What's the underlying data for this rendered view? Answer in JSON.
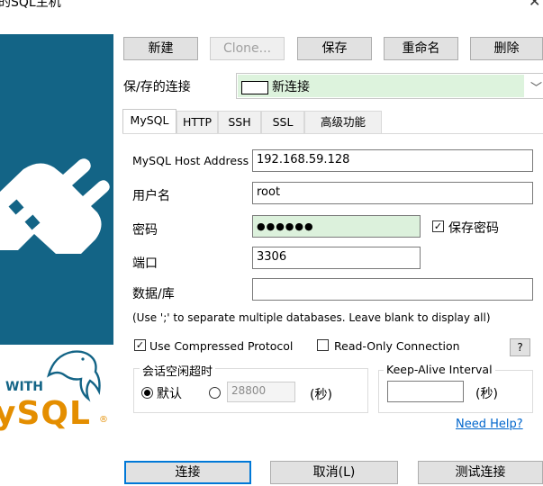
{
  "window": {
    "title": "的SQL主机",
    "close_glyph": "✕"
  },
  "sidebar": {
    "logo_with": "WITH",
    "logo_brand": "ySQL",
    "logo_trademark": "®",
    "plug_icon": "plug-icon",
    "dolphin_icon": "dolphin-icon"
  },
  "toolbar": {
    "new_label": "新建",
    "clone_label": "Clone...",
    "save_label": "保存",
    "rename_label": "重命名",
    "delete_label": "删除"
  },
  "saved_connections": {
    "label": "保/存的连接",
    "value": "新连接",
    "arrow": "﹀"
  },
  "tabs": [
    {
      "label": "MySQL",
      "active": true
    },
    {
      "label": "HTTP"
    },
    {
      "label": "SSH"
    },
    {
      "label": "SSL"
    },
    {
      "label": "高级功能"
    }
  ],
  "form": {
    "host_label": "MySQL Host Address",
    "host_value": "192.168.59.128",
    "user_label": "用户名",
    "user_value": "root",
    "password_label": "密码",
    "password_value": "●●●●●●",
    "save_password_checked": "✓",
    "save_password_label": "保存密码",
    "port_label": "端口",
    "port_value": "3306",
    "database_label": "数据/库",
    "database_value": "",
    "database_hint": "(Use ';' to separate multiple databases. Leave blank to display all)",
    "compressed_checked": "✓",
    "compressed_label": "Use Compressed Protocol",
    "readonly_checked": "",
    "readonly_label": "Read-Only Connection",
    "help_label": "?"
  },
  "session_timeout": {
    "group_label": "会话空闲超时",
    "default_label": "默认",
    "custom_value": "28800",
    "unit_label": "(秒)"
  },
  "keepalive": {
    "group_label": "Keep-Alive Interval",
    "value": "",
    "unit_label": "(秒)"
  },
  "need_help_link": "Need Help?",
  "footer": {
    "connect_label": "连接",
    "cancel_label": "取消(L)",
    "test_label": "测试连接"
  },
  "colors": {
    "sidebar_blue": "#136486",
    "mysql_orange": "#e48e00",
    "focus_blue": "#0078d7",
    "link_blue": "#0066cc"
  }
}
